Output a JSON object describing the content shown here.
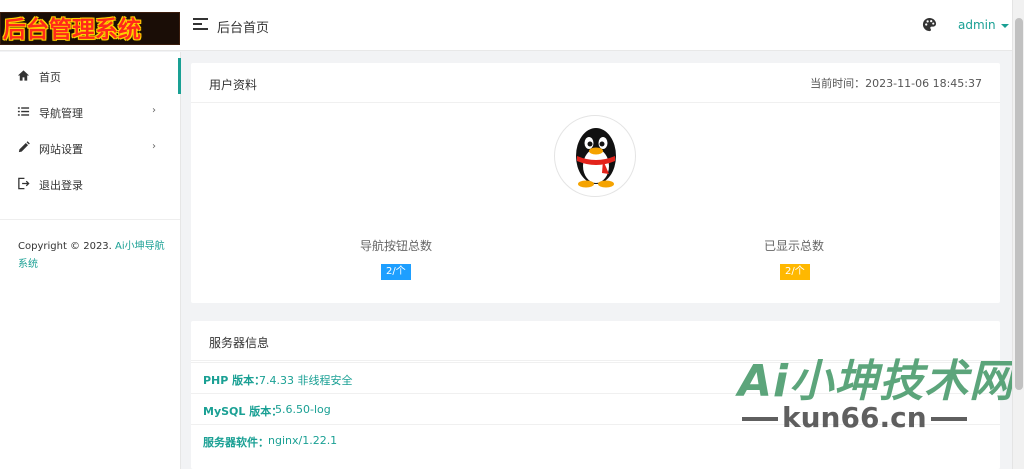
{
  "header": {
    "logo_text": "后台管理系统",
    "title": "后台首页",
    "user": "admin",
    "accent": "#1aa094"
  },
  "sidebar": {
    "items": [
      {
        "label": "首页",
        "icon": "home-icon",
        "active": true
      },
      {
        "label": "导航管理",
        "icon": "list-icon",
        "has_children": true
      },
      {
        "label": "网站设置",
        "icon": "pencil-icon",
        "has_children": true
      },
      {
        "label": "退出登录",
        "icon": "logout-icon"
      }
    ],
    "arrow": "›",
    "copyright_prefix": "Copyright © 2023. ",
    "copyright_brand": "Ai小坤导航系统"
  },
  "profile": {
    "title": "用户资料",
    "time_label": "当前时间：",
    "time_value": "2023-11-06 18:45:37",
    "stats": [
      {
        "label": "导航按钮总数",
        "value": "2/个",
        "color": "#1e9fff"
      },
      {
        "label": "已显示总数",
        "value": "2/个",
        "color": "#ffb800"
      }
    ]
  },
  "server": {
    "title": "服务器信息",
    "rows": [
      {
        "key": "PHP 版本：",
        "value": "7.4.33 非线程安全"
      },
      {
        "key": "MySQL 版本：",
        "value": "5.6.50-log"
      },
      {
        "key": "服务器软件：",
        "value": "nginx/1.22.1"
      }
    ]
  },
  "watermark": {
    "title": "Ai小坤技术网",
    "domain": "kun66.cn"
  }
}
